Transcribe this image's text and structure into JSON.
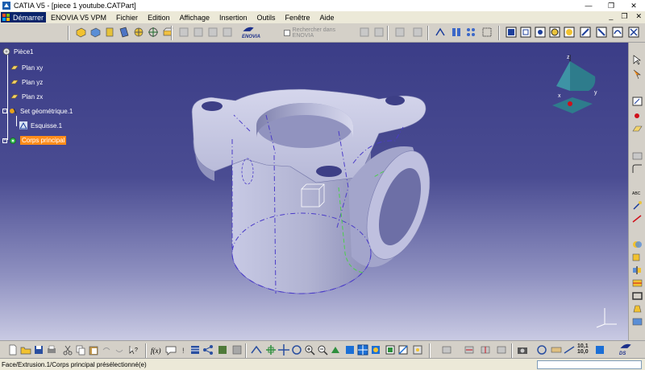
{
  "window": {
    "title": "CATIA V5 - [piece 1 youtube.CATPart]",
    "controls": [
      "—",
      "❐",
      "✕"
    ],
    "mdi_controls": [
      "_",
      "❐",
      "✕"
    ]
  },
  "menu": {
    "start_label": "Démarrer",
    "items": [
      "ENOVIA V5 VPM",
      "Fichier",
      "Edition",
      "Affichage",
      "Insertion",
      "Outils",
      "Fenêtre",
      "Aide"
    ]
  },
  "toolbar": {
    "enovia_logo": "ENOVIA",
    "search_placeholder": "Rechercher dans ENOVIA"
  },
  "tree": {
    "root": "Pièce1",
    "planes": [
      "Plan xy",
      "Plan yz",
      "Plan zx"
    ],
    "geoset": "Set géométrique.1",
    "sketch": "Esquisse.1",
    "body": "Corps principal"
  },
  "compass": {
    "x": "x",
    "y": "y",
    "z": "z"
  },
  "bottom_toolbar": {
    "zoom_top": "10,1",
    "zoom_bottom": "10,0",
    "ds_logo": "DS"
  },
  "status": {
    "text": "Face/Extrusion.1/Corps principal présélectionné(e)"
  },
  "colors": {
    "background_top": "#3b3d87",
    "background_bottom": "#c9cae3",
    "selection": "#ff8c1a",
    "part_face": "#b9bbd8",
    "compass_teal": "#2e7c8c"
  }
}
